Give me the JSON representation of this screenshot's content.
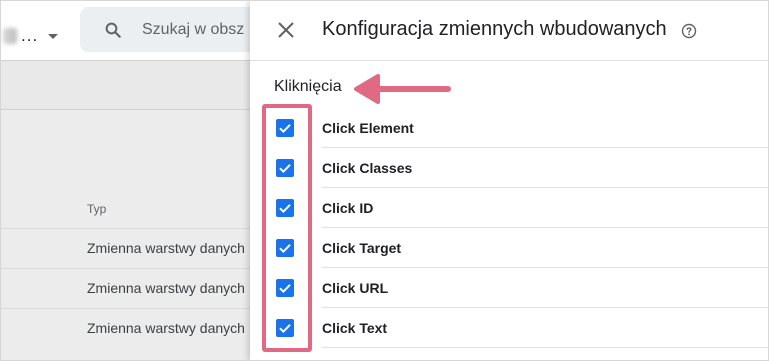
{
  "background": {
    "account_label": "...",
    "search": {
      "placeholder": "Szukaj w obsz"
    },
    "table": {
      "type_header": "Typ",
      "rows": [
        "Zmienna warstwy danych",
        "Zmienna warstwy danych",
        "Zmienna warstwy danych"
      ]
    }
  },
  "panel": {
    "title": "Konfiguracja zmiennych wbudowanych",
    "section_title": "Kliknięcia",
    "items": [
      {
        "label": "Click Element",
        "checked": true
      },
      {
        "label": "Click Classes",
        "checked": true
      },
      {
        "label": "Click ID",
        "checked": true
      },
      {
        "label": "Click Target",
        "checked": true
      },
      {
        "label": "Click URL",
        "checked": true
      },
      {
        "label": "Click Text",
        "checked": true
      }
    ]
  },
  "colors": {
    "checkbox": "#1a73e8",
    "annotation": "#e06a83"
  },
  "icons": [
    "search-icon",
    "close-icon",
    "help-icon",
    "checkmark-icon",
    "chevron-down-icon",
    "arrow-annotation"
  ]
}
